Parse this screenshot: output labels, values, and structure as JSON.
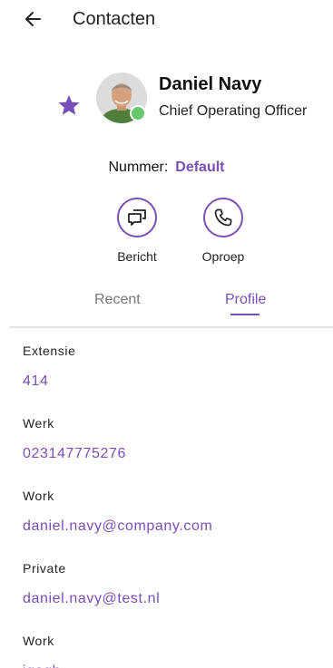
{
  "header": {
    "title": "Contacten",
    "back_icon": "arrow-left-icon"
  },
  "contact": {
    "name": "Daniel Navy",
    "job_title": "Chief Operating Officer",
    "favorite_icon": "star-icon",
    "status": "online",
    "status_color": "#63c96b"
  },
  "number": {
    "label": "Nummer:",
    "value": "Default"
  },
  "actions": [
    {
      "label": "Bericht",
      "icon": "message-icon"
    },
    {
      "label": "Oproep",
      "icon": "phone-icon"
    }
  ],
  "tabs": [
    {
      "label": "Recent",
      "active": false
    },
    {
      "label": "Profile",
      "active": true
    }
  ],
  "fields": [
    {
      "label": "Extensie",
      "value": "414"
    },
    {
      "label": "Werk",
      "value": "023147775276"
    },
    {
      "label": "Work",
      "value": "daniel.navy@company.com"
    },
    {
      "label": "Private",
      "value": "daniel.navy@test.nl"
    },
    {
      "label": "Work",
      "value": "igegh"
    }
  ],
  "colors": {
    "accent": "#7a4fb8",
    "text": "#222222",
    "divider": "#e6e6e6"
  }
}
